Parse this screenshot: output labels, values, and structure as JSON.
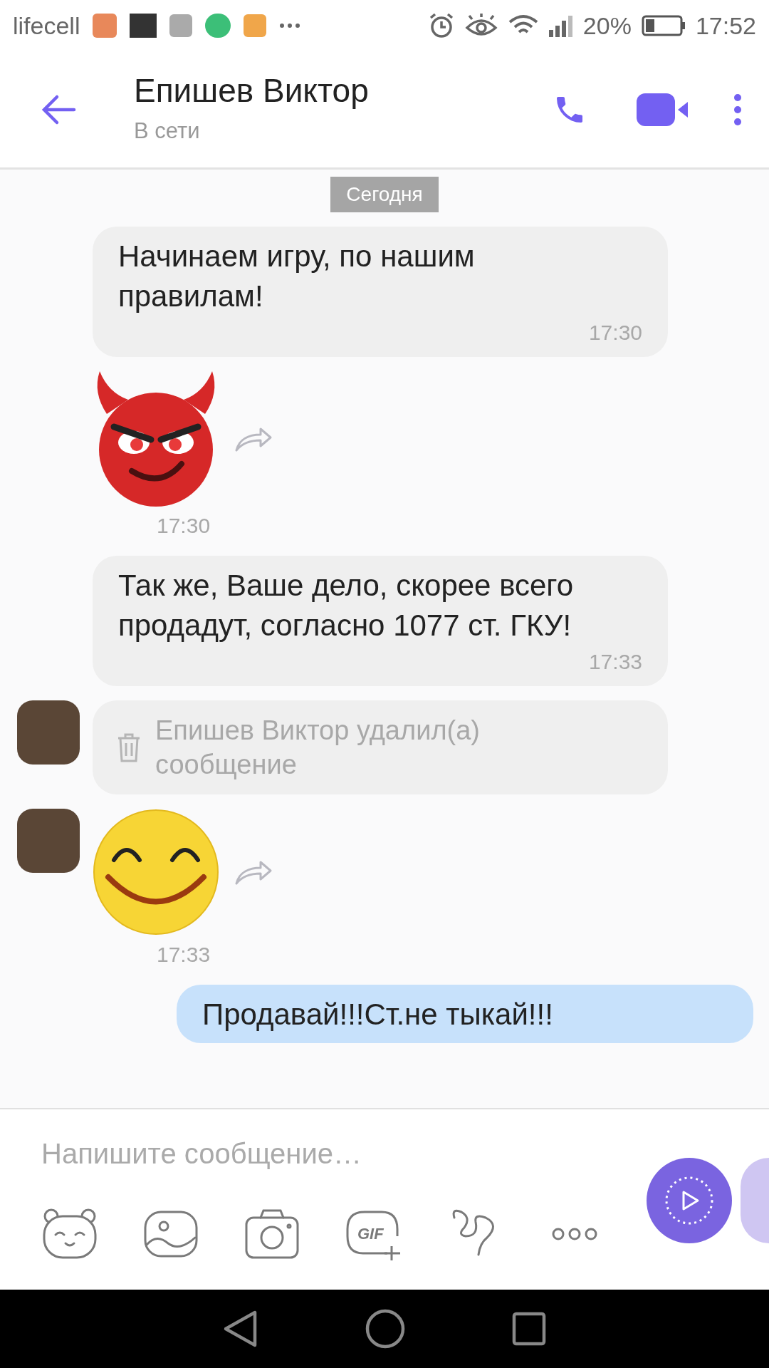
{
  "status_bar": {
    "carrier": "lifecell",
    "battery": "20%",
    "time": "17:52"
  },
  "header": {
    "name": "Епишев Виктор",
    "status": "В сети"
  },
  "date_divider": "Сегодня",
  "messages": [
    {
      "kind": "text",
      "outgoing": false,
      "avatar": false,
      "text": "Начинаем игру, по нашим правилам!",
      "time": "17:30"
    },
    {
      "kind": "devil",
      "avatar": false,
      "time": "17:30"
    },
    {
      "kind": "text",
      "outgoing": false,
      "avatar": false,
      "text": "Так же, Ваше дело, скорее всего продадут, согласно 1077 ст. ГКУ!",
      "time": "17:33"
    },
    {
      "kind": "deleted",
      "avatar": true,
      "text": "Епишев Виктор удалил(а) сообщение"
    },
    {
      "kind": "smiley",
      "avatar": true,
      "time": "17:33"
    },
    {
      "kind": "text",
      "outgoing": true,
      "text": "Продавай!!!Ст.не тыкай!!!"
    }
  ],
  "composer": {
    "placeholder": "Напишите сообщение…",
    "gif_label": "GIF"
  }
}
